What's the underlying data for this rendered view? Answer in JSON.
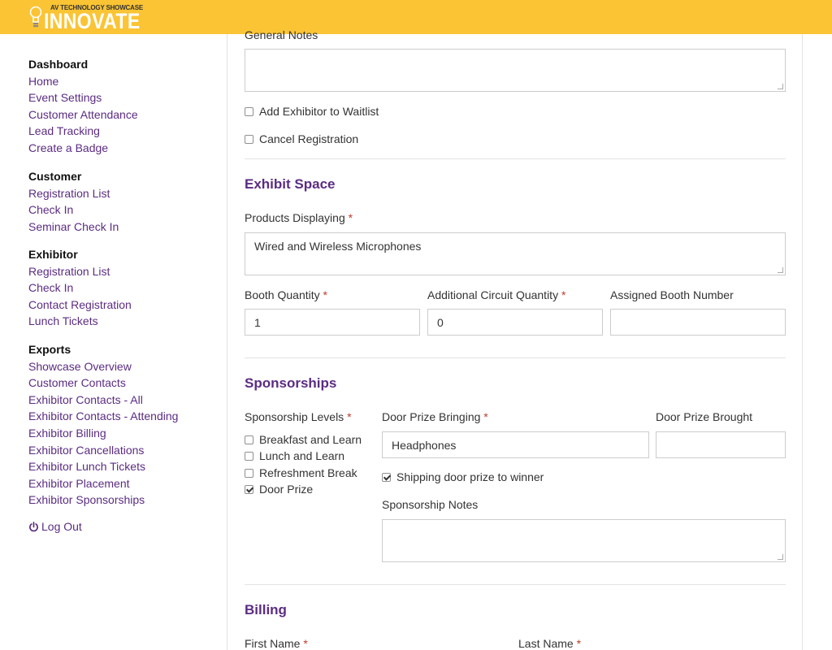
{
  "header": {
    "logo_small": "AV TECHNOLOGY SHOWCASE",
    "logo_big": "INNOVATE",
    "brand_color": "#fbc434",
    "accent_color": "#5b2c82"
  },
  "sidebar": {
    "groups": [
      {
        "heading": "Dashboard",
        "items": [
          "Home",
          "Event Settings",
          "Customer Attendance",
          "Lead Tracking",
          "Create a Badge"
        ]
      },
      {
        "heading": "Customer",
        "items": [
          "Registration List",
          "Check In",
          "Seminar Check In"
        ]
      },
      {
        "heading": "Exhibitor",
        "items": [
          "Registration List",
          "Check In",
          "Contact Registration",
          "Lunch Tickets"
        ]
      },
      {
        "heading": "Exports",
        "items": [
          "Showcase Overview",
          "Customer Contacts",
          "Exhibitor Contacts - All",
          "Exhibitor Contacts - Attending",
          "Exhibitor Billing",
          "Exhibitor Cancellations",
          "Exhibitor Lunch Tickets",
          "Exhibitor Placement",
          "Exhibitor Sponsorships"
        ]
      }
    ],
    "logout_label": "Log Out",
    "logout_icon": "power-icon"
  },
  "form": {
    "general_notes": {
      "label": "General Notes",
      "value": ""
    },
    "waitlist": {
      "label": "Add Exhibitor to Waitlist",
      "checked": false
    },
    "cancel": {
      "label": "Cancel Registration",
      "checked": false
    },
    "exhibit_space": {
      "title": "Exhibit Space",
      "products_label": "Products Displaying",
      "products_value": "Wired and Wireless Microphones",
      "booth_qty_label": "Booth Quantity",
      "booth_qty_value": "1",
      "circuit_label": "Additional Circuit Quantity",
      "circuit_value": "0",
      "booth_number_label": "Assigned Booth Number",
      "booth_number_value": ""
    },
    "sponsorships": {
      "title": "Sponsorships",
      "levels_label": "Sponsorship Levels",
      "levels": [
        {
          "label": "Breakfast and Learn",
          "checked": false
        },
        {
          "label": "Lunch and Learn",
          "checked": false
        },
        {
          "label": "Refreshment Break",
          "checked": false
        },
        {
          "label": "Door Prize",
          "checked": true
        }
      ],
      "door_prize_bringing_label": "Door Prize Bringing",
      "door_prize_bringing_value": "Headphones",
      "door_prize_brought_label": "Door Prize Brought",
      "door_prize_brought_value": "",
      "shipping_label": "Shipping door prize to winner",
      "shipping_checked": true,
      "notes_label": "Sponsorship Notes",
      "notes_value": ""
    },
    "billing": {
      "title": "Billing",
      "first_name_label": "First Name",
      "last_name_label": "Last Name"
    },
    "required_mark": "*"
  }
}
